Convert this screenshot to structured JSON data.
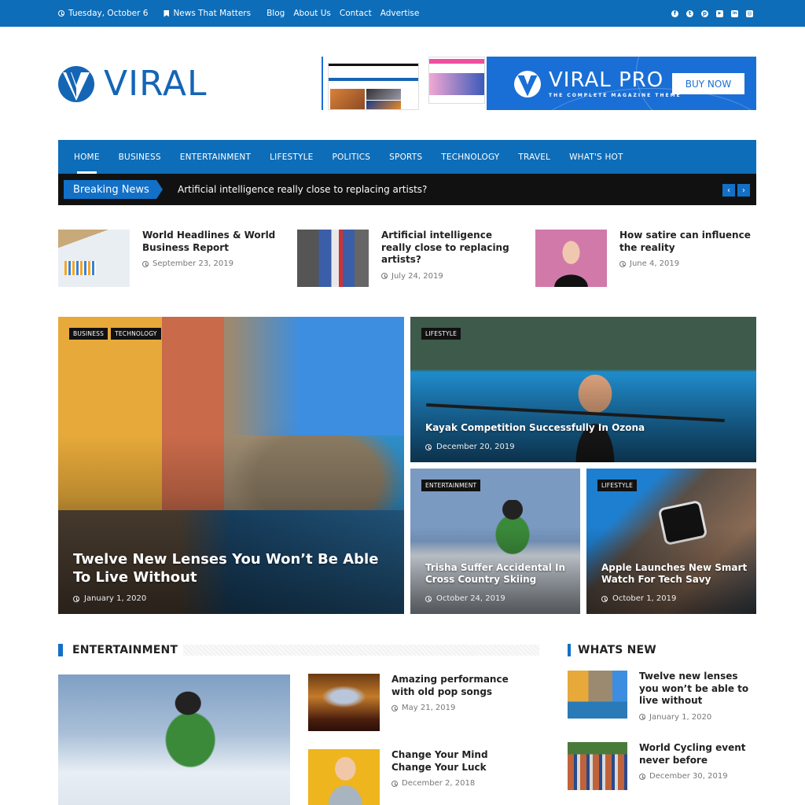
{
  "topbar": {
    "date": "Tuesday, October 6",
    "tagline": "News That Matters",
    "menu": [
      "Blog",
      "About Us",
      "Contact",
      "Advertise"
    ],
    "social": [
      {
        "icon": "facebook-icon",
        "glyph": "f"
      },
      {
        "icon": "twitter-icon",
        "glyph": "t"
      },
      {
        "icon": "pinterest-icon",
        "glyph": "p"
      },
      {
        "icon": "youtube-icon",
        "glyph": "▶"
      },
      {
        "icon": "linkedin-icon",
        "glyph": "in"
      },
      {
        "icon": "instagram-icon",
        "glyph": "◎"
      }
    ]
  },
  "logo": {
    "text": "VIRAL"
  },
  "ad": {
    "brand": "VIRAL PRO",
    "subtitle": "THE COMPLETE MAGAZINE THEME",
    "button": "BUY NOW"
  },
  "nav": {
    "items": [
      "HOME",
      "BUSINESS",
      "ENTERTAINMENT",
      "LIFESTYLE",
      "POLITICS",
      "SPORTS",
      "TECHNOLOGY",
      "TRAVEL",
      "WHAT'S HOT"
    ],
    "active": "HOME"
  },
  "breaking": {
    "label": "Breaking News",
    "headline": "Artificial intelligence really close to replacing artists?",
    "prev": "‹",
    "next": "›"
  },
  "top_posts": [
    {
      "title": "World Headlines & World Business Report",
      "date": "September 23, 2019"
    },
    {
      "title": "Artificial intelligence really close to replacing artists?",
      "date": "July 24, 2019"
    },
    {
      "title": "How satire can influence the reality",
      "date": "June 4, 2019"
    }
  ],
  "featured": {
    "main": {
      "tags": [
        "BUSINESS",
        "TECHNOLOGY"
      ],
      "title": "Twelve New Lenses You Won’t Be Able To Live Without",
      "date": "January 1, 2020"
    },
    "right_top": {
      "tags": [
        "LIFESTYLE"
      ],
      "title": "Kayak Competition Successfully In Ozona",
      "date": "December 20, 2019"
    },
    "right_bottom_left": {
      "tags": [
        "ENTERTAINMENT"
      ],
      "title": "Trisha Suffer Accidental In Cross Country Skiing",
      "date": "October 24, 2019"
    },
    "right_bottom_right": {
      "tags": [
        "LIFESTYLE"
      ],
      "title": "Apple Launches New Smart Watch For Tech Savy",
      "date": "October 1, 2019"
    }
  },
  "entertainment": {
    "heading": "ENTERTAINMENT",
    "items": [
      {
        "title": "Amazing performance with old pop songs",
        "date": "May 21, 2019"
      },
      {
        "title": "Change Your Mind Change Your Luck",
        "date": "December 2, 2018"
      }
    ]
  },
  "whats_new": {
    "heading": "WHATS NEW",
    "items": [
      {
        "title": "Twelve new lenses you won’t be able to live without",
        "date": "January 1, 2020"
      },
      {
        "title": "World Cycling event never before",
        "date": "December 30, 2019"
      }
    ]
  },
  "colors": {
    "brand": "#0e6db8",
    "dark": "#111111",
    "accent": "#1270c6"
  }
}
